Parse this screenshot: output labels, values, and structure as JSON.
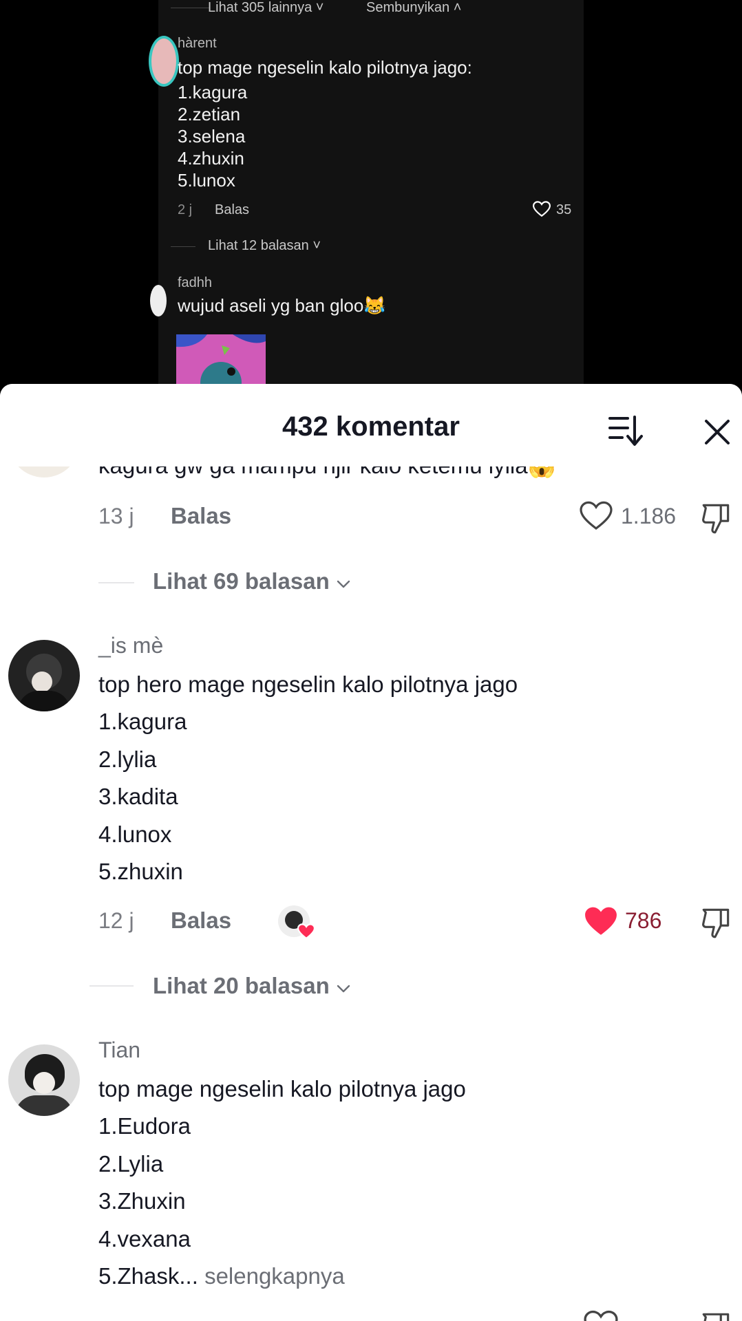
{
  "video": {
    "see_more": "Lihat 305 lainnya ˅",
    "hide": "Sembunyikan ˄",
    "comment1": {
      "user": "hàrent",
      "lines": [
        "top mage ngeselin kalo pilotnya jago:",
        "1.kagura",
        "2.zetian",
        "3.selena",
        "4.zhuxin",
        "5.lunox"
      ],
      "time": "2 j",
      "reply": "Balas",
      "likes": "35"
    },
    "view_replies": "Lihat 12 balasan ˅",
    "comment2": {
      "user": "fadhh",
      "text": "wujud aseli yg ban gloo😹"
    }
  },
  "sheet": {
    "title": "432 komentar",
    "partial_comment": {
      "text": "kagura gw ga mampu njir kalo ketemu lylia😱",
      "time": "13 j",
      "reply": "Balas",
      "likes": "1.186",
      "view_replies": "Lihat 69 balasan"
    },
    "comments": [
      {
        "user": "_is mè",
        "lines": [
          "top hero mage ngeselin kalo pilotnya jago",
          "1.kagura",
          "2.lylia",
          "3.kadita",
          "4.lunox",
          "5.zhuxin"
        ],
        "time": "12 j",
        "reply": "Balas",
        "likes": "786",
        "liked": true,
        "view_replies": "Lihat 20 balasan"
      },
      {
        "user": "Tian",
        "lines": [
          "top mage ngeselin kalo pilotnya jago",
          "1.Eudora",
          "2.Lylia",
          "3.Zhuxin",
          "4.vexana",
          "5.Zhask..."
        ],
        "see_more": "selengkapnya"
      }
    ]
  },
  "colors": {
    "like_red": "#fe2c55",
    "text_primary": "#161823",
    "text_secondary": "#6b6e75"
  }
}
